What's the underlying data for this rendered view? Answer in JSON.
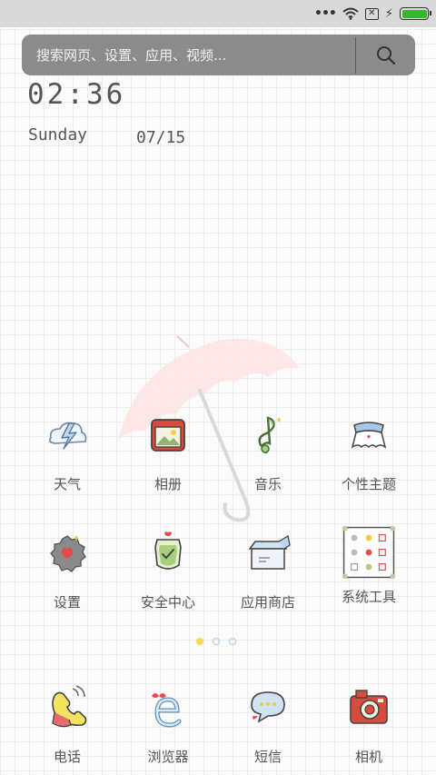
{
  "status_bar": {
    "more": "•••",
    "sim": "✕",
    "battery_level": 1.0,
    "battery_color": "#34b728"
  },
  "search": {
    "placeholder": "搜索网页、设置、应用、视频..."
  },
  "clock": {
    "time": "02:36",
    "day": "Sunday",
    "date": "07/15"
  },
  "apps": {
    "weather": "天气",
    "gallery": "相册",
    "music": "音乐",
    "themes": "个性主题",
    "settings": "设置",
    "security": "安全中心",
    "app_store": "应用商店",
    "tools": "系统工具"
  },
  "pager": {
    "current_page": 1,
    "page_count": 3,
    "active_color": "#f2dc5b",
    "inactive_color": "#a6c8e6"
  },
  "dock": {
    "phone": "电话",
    "browser": "浏览器",
    "messages": "短信",
    "camera": "相机"
  }
}
